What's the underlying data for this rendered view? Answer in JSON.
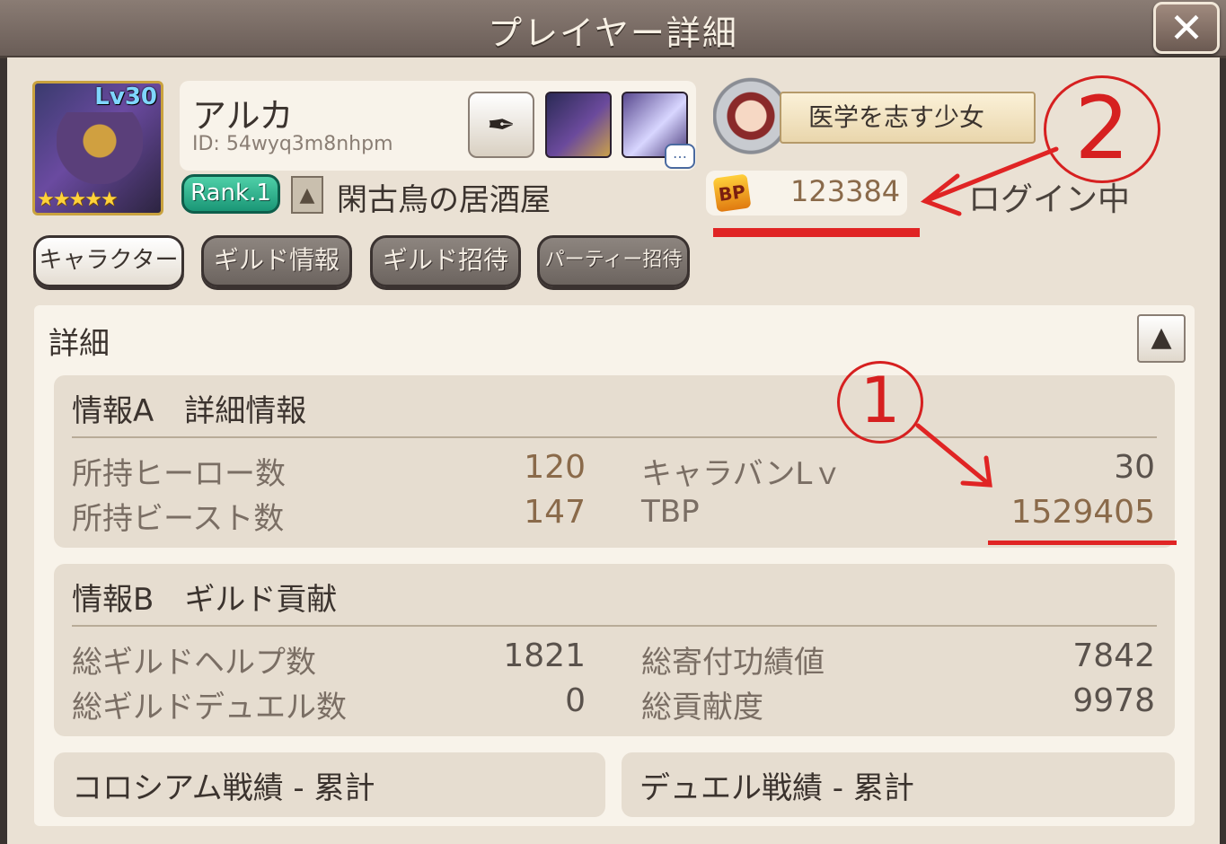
{
  "window": {
    "title": "プレイヤー詳細",
    "close_label": "✕"
  },
  "player": {
    "level": "Lv30",
    "stars": "★★★★★",
    "name": "アルカ",
    "id": "ID: 54wyq3m8nhpm",
    "rank": "Rank.1",
    "guild_name": "閑古鳥の居酒屋",
    "title": "医学を志す少女",
    "bp_icon_text": "BP",
    "bp": "123384",
    "status": "ログイン中"
  },
  "tabs": [
    "キャラクター",
    "ギルド情報",
    "ギルド招待",
    "パーティー招待"
  ],
  "details": {
    "title": "詳細",
    "collapse_icon": "▲",
    "info_a": {
      "title": "情報A　詳細情報",
      "rows": [
        {
          "label": "所持ヒーロー数",
          "value": "120"
        },
        {
          "label": "所持ビースト数",
          "value": "147"
        },
        {
          "label": "キャラバンLｖ",
          "value": "30"
        },
        {
          "label": "TBP",
          "value": "1529405"
        }
      ]
    },
    "info_b": {
      "title": "情報B　ギルド貢献",
      "rows": [
        {
          "label": "総ギルドヘルプ数",
          "value": "1821"
        },
        {
          "label": "総ギルドデュエル数",
          "value": "0"
        },
        {
          "label": "総寄付功績値",
          "value": "7842"
        },
        {
          "label": "総貢献度",
          "value": "9978"
        }
      ]
    },
    "colosseum_title": "コロシアム戦績 - 累計",
    "duel_title": "デュエル戦績 - 累計"
  },
  "annotations": {
    "circle_1": "1",
    "circle_2": "2",
    "color": "#e02424"
  },
  "colors": {
    "rank_badge": "#1a9676",
    "accent_value": "#8a6a4a",
    "panel": "#eae1d4"
  }
}
